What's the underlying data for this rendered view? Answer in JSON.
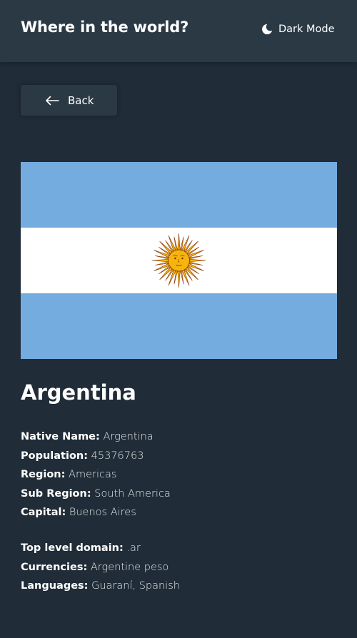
{
  "header": {
    "title": "Where in the world?",
    "mode_toggle": {
      "icon": "moon-icon",
      "label": "Dark Mode"
    }
  },
  "back_button": {
    "icon": "arrow-left-icon",
    "label": "Back"
  },
  "country": {
    "name": "Argentina",
    "flag": {
      "stripe_color": "#74acdf",
      "center_color": "#ffffff",
      "sun_color": "#f6b40e",
      "sun_outline": "#85340a"
    },
    "details_primary": [
      {
        "label": "Native Name:",
        "value": "Argentina"
      },
      {
        "label": "Population:",
        "value": "45376763"
      },
      {
        "label": "Region:",
        "value": "Americas"
      },
      {
        "label": "Sub Region:",
        "value": "South America"
      },
      {
        "label": "Capital:",
        "value": "Buenos Aires"
      }
    ],
    "details_secondary": [
      {
        "label": "Top level domain:",
        "value": ".ar"
      },
      {
        "label": "Currencies:",
        "value": "Argentine peso"
      },
      {
        "label": "Languages:",
        "value": "Guaraní, Spanish"
      }
    ]
  },
  "theme": {
    "background": "#202c37",
    "element": "#2b3945",
    "text": "#ffffff"
  }
}
